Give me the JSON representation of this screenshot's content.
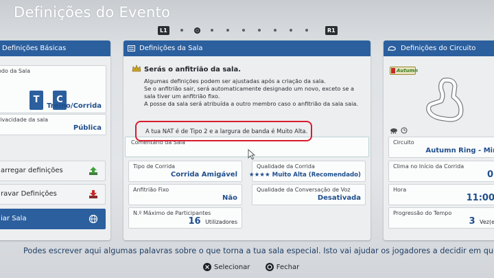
{
  "title": "Definições do Evento",
  "pager": {
    "left_key": "L1",
    "right_key": "R1"
  },
  "basic": {
    "header": "Definições Básicas",
    "mode_label": "odo da Sala",
    "mode_keys": [
      "T",
      "C"
    ],
    "mode_value": "Treino/Corrida",
    "privacy_label": "rivacidade da sala",
    "privacy_value": "Pública",
    "load_label": "arregar definições",
    "save_label": "ravar Definições",
    "create_label": "iar Sala"
  },
  "room": {
    "header": "Definições da Sala",
    "host_title": "Serás o anfitrião da sala.",
    "host_lines": [
      "Algumas definições podem ser ajustadas após a criação da sala.",
      "Se o anfitrião sair, será automaticamente designado um novo, exceto se a",
      "sala tiver um anfitrião fixo.",
      "A posse da sala será atribuída a outro membro caso o anfitrião da sala saia."
    ],
    "nat_text": "A tua NAT é de Tipo 2 e a largura de banda é Muito Alta.",
    "comment_label": "Comentário da Sala",
    "race_type_label": "Tipo de Corrida",
    "race_type_value": "Corrida Amigável",
    "quality_label": "Qualidade da Corrida",
    "quality_value": "★★★★ Muito Alta (Recomendado)",
    "fixed_host_label": "Anfitrião Fixo",
    "fixed_host_value": "Não",
    "voice_label": "Qualidade da Conversação de Voz",
    "voice_value": "Desativada",
    "max_players_label": "N.º Máximo de Participantes",
    "max_players_value": "16",
    "max_players_unit": "Utilizadores"
  },
  "circuit": {
    "header": "Definições do Circuito",
    "logo_text": "Autumn",
    "circuit_label": "Circuito",
    "circuit_value": "Autumn Ring - Mir",
    "weather_label": "Clima no Início da Corrida",
    "weather_value": "0",
    "time_label": "Hora",
    "time_value": "11:00",
    "progress_label": "Progressão do Tempo",
    "progress_value": "3",
    "progress_unit": "Vez(e"
  },
  "footer": {
    "hint": "Podes escrever aqui algumas palavras sobre o que torna a tua sala especial. Isto vai ajudar os jogadores a decidir em que sal",
    "select_label": "Selecionar",
    "close_label": "Fechar"
  },
  "colors": {
    "accent": "#2b5f9e",
    "value": "#1f4e8c",
    "highlight": "#d81b2a"
  }
}
